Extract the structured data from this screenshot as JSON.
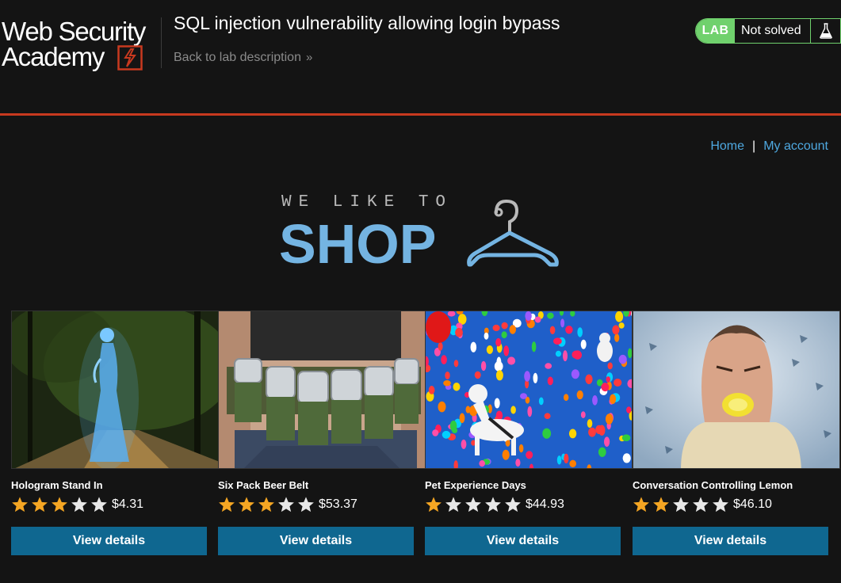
{
  "header": {
    "logo_line1": "Web Security",
    "logo_line2": "Academy",
    "lab_title": "SQL injection vulnerability allowing login bypass",
    "back_link": "Back to lab description",
    "lab_badge": "LAB",
    "status": "Not solved"
  },
  "nav": {
    "home": "Home",
    "separator": "|",
    "account": "My account"
  },
  "banner": {
    "tagline": "WE LIKE TO",
    "title": "SHOP"
  },
  "colors": {
    "accent_red": "#c8391f",
    "status_green": "#70d16d",
    "link_blue": "#4ea8e0",
    "button_blue": "#0f6790",
    "shop_blue": "#74b4e2",
    "star_gold": "#f5a623"
  },
  "products": [
    {
      "name": "Hologram Stand In",
      "rating": 3,
      "max_rating": 5,
      "price": "$4.31",
      "button": "View details",
      "image": "hologram-woman-park"
    },
    {
      "name": "Six Pack Beer Belt",
      "rating": 3,
      "max_rating": 5,
      "price": "$53.37",
      "button": "View details",
      "image": "beer-can-belt"
    },
    {
      "name": "Pet Experience Days",
      "rating": 1,
      "max_rating": 5,
      "price": "$44.93",
      "button": "View details",
      "image": "dogs-with-balloons"
    },
    {
      "name": "Conversation Controlling Lemon",
      "rating": 2,
      "max_rating": 5,
      "price": "$46.10",
      "button": "View details",
      "image": "man-biting-lemon"
    }
  ]
}
